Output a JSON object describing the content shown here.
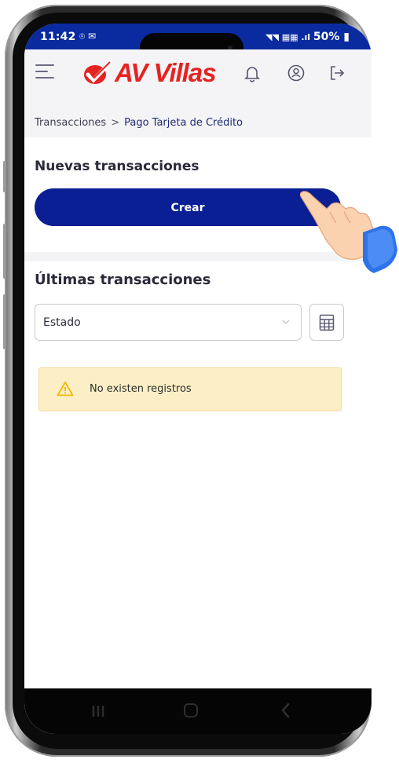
{
  "status_bar": {
    "time": "11:42",
    "battery": "50%"
  },
  "header": {
    "brand": "AV Villas",
    "icons": [
      "menu-icon",
      "bell-icon",
      "profile-icon",
      "logout-icon"
    ]
  },
  "breadcrumb": {
    "parent": "Transacciones",
    "separator": ">",
    "current": "Pago Tarjeta de Crédito"
  },
  "new_transactions": {
    "title": "Nuevas transacciones",
    "create_label": "Crear"
  },
  "last_transactions": {
    "title": "Últimas transacciones",
    "filter_value": "Estado",
    "empty_message": "No existen registros"
  },
  "colors": {
    "brand_blue": "#0a1f94",
    "brand_red": "#e52322",
    "alert_bg": "#fcefc6",
    "alert_icon": "#f2b705"
  }
}
